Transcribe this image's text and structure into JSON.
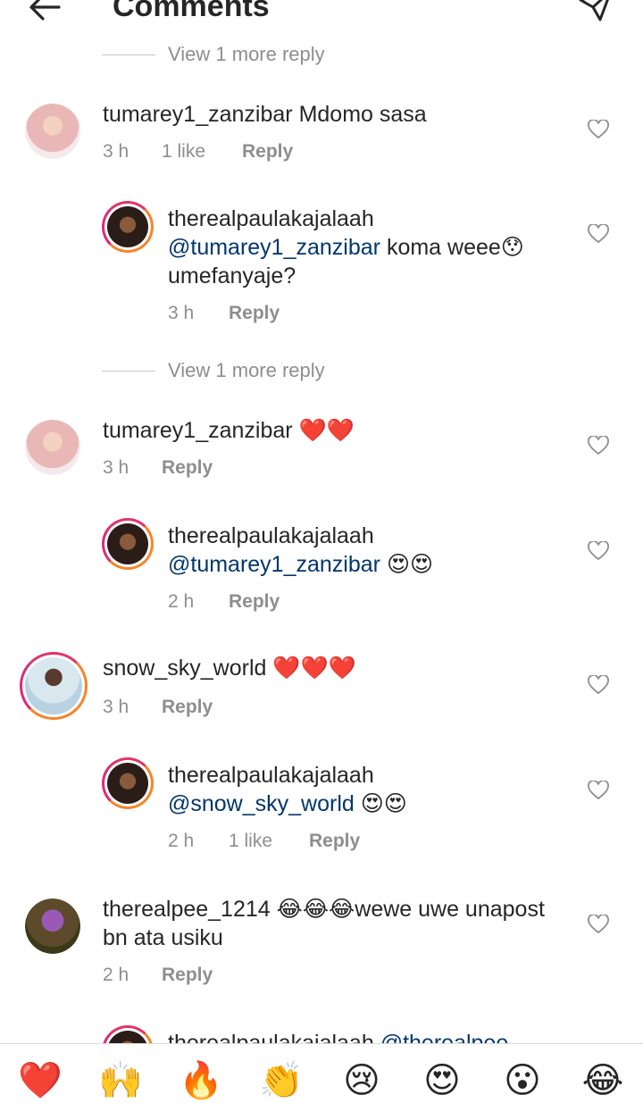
{
  "header": {
    "title": "Comments",
    "back_icon": "arrow-left-icon",
    "send_icon": "paper-plane-icon"
  },
  "view_more_top": "View 1 more reply",
  "view_more_mid": "View 1 more reply",
  "comments": [
    {
      "username": "tumarey1_zanzibar",
      "text": "Mdomo sasa",
      "time": "3 h",
      "likes": "1 like",
      "reply": "Reply"
    },
    {
      "username": "therealpaulakajalaah",
      "mention": "@tumarey1_zanzibar",
      "text": "koma weee😯 umefanyaje?",
      "time": "3 h",
      "reply": "Reply"
    },
    {
      "username": "tumarey1_zanzibar",
      "text": "❤️❤️",
      "time": "3 h",
      "reply": "Reply"
    },
    {
      "username": "therealpaulakajalaah",
      "mention": "@tumarey1_zanzibar",
      "text": "😍😍",
      "time": "2 h",
      "reply": "Reply"
    },
    {
      "username": "snow_sky_world",
      "text": "❤️❤️❤️",
      "time": "3 h",
      "reply": "Reply"
    },
    {
      "username": "therealpaulakajalaah",
      "mention": "@snow_sky_world",
      "text": "😍😍",
      "time": "2 h",
      "likes": "1 like",
      "reply": "Reply"
    },
    {
      "username": "therealpee_1214",
      "text": "😂😂😂wewe uwe unapost bn ata usiku",
      "time": "2 h",
      "reply": "Reply"
    },
    {
      "username": "therealpaulakajalaah",
      "mention": "@therealpee"
    }
  ],
  "emoji_bar": [
    "❤️",
    "🙌",
    "🔥",
    "👏",
    "😢",
    "😍",
    "😮",
    "😂"
  ],
  "colors": {
    "text": "#262626",
    "secondary": "#8e8e8e",
    "mention": "#00376b",
    "story_ring": "#dd2a7b"
  }
}
